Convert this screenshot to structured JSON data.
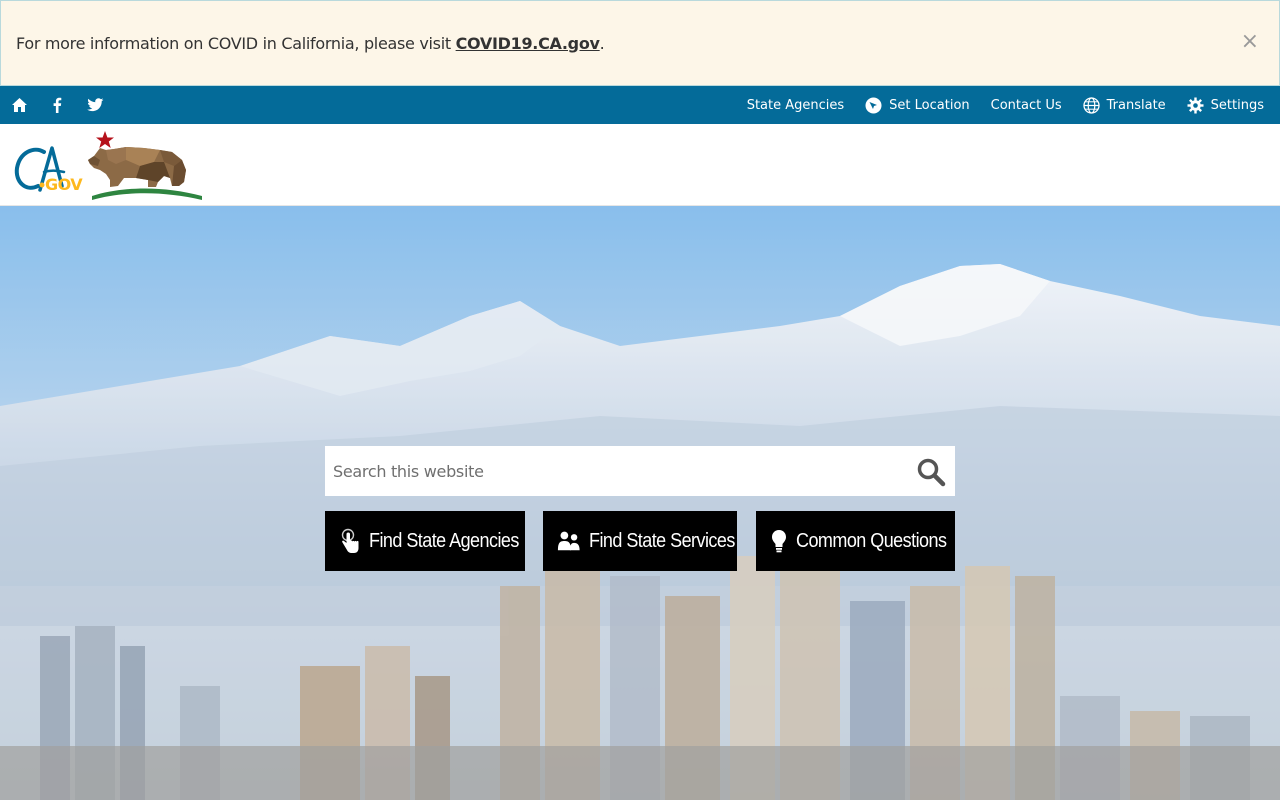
{
  "alert": {
    "message": "For more information on COVID in California, please visit ",
    "link_text": "COVID19.CA.gov",
    "suffix": ".",
    "close_symbol": "×"
  },
  "utility": {
    "left_icons": [
      "home-icon",
      "facebook-icon",
      "twitter-icon"
    ],
    "links": {
      "state_agencies": "State Agencies",
      "set_location": "Set Location",
      "contact_us": "Contact Us",
      "translate": "Translate",
      "settings": "Settings"
    }
  },
  "branding": {
    "logo_text": "CA.GOV"
  },
  "search": {
    "placeholder": "Search this website"
  },
  "quick_links": {
    "agencies": "Find State Agencies",
    "services": "Find State Services",
    "questions": "Common Questions"
  },
  "colors": {
    "utility_bar": "#046b99",
    "alert_bg": "#fdf6e8",
    "button_bg": "#000000"
  }
}
